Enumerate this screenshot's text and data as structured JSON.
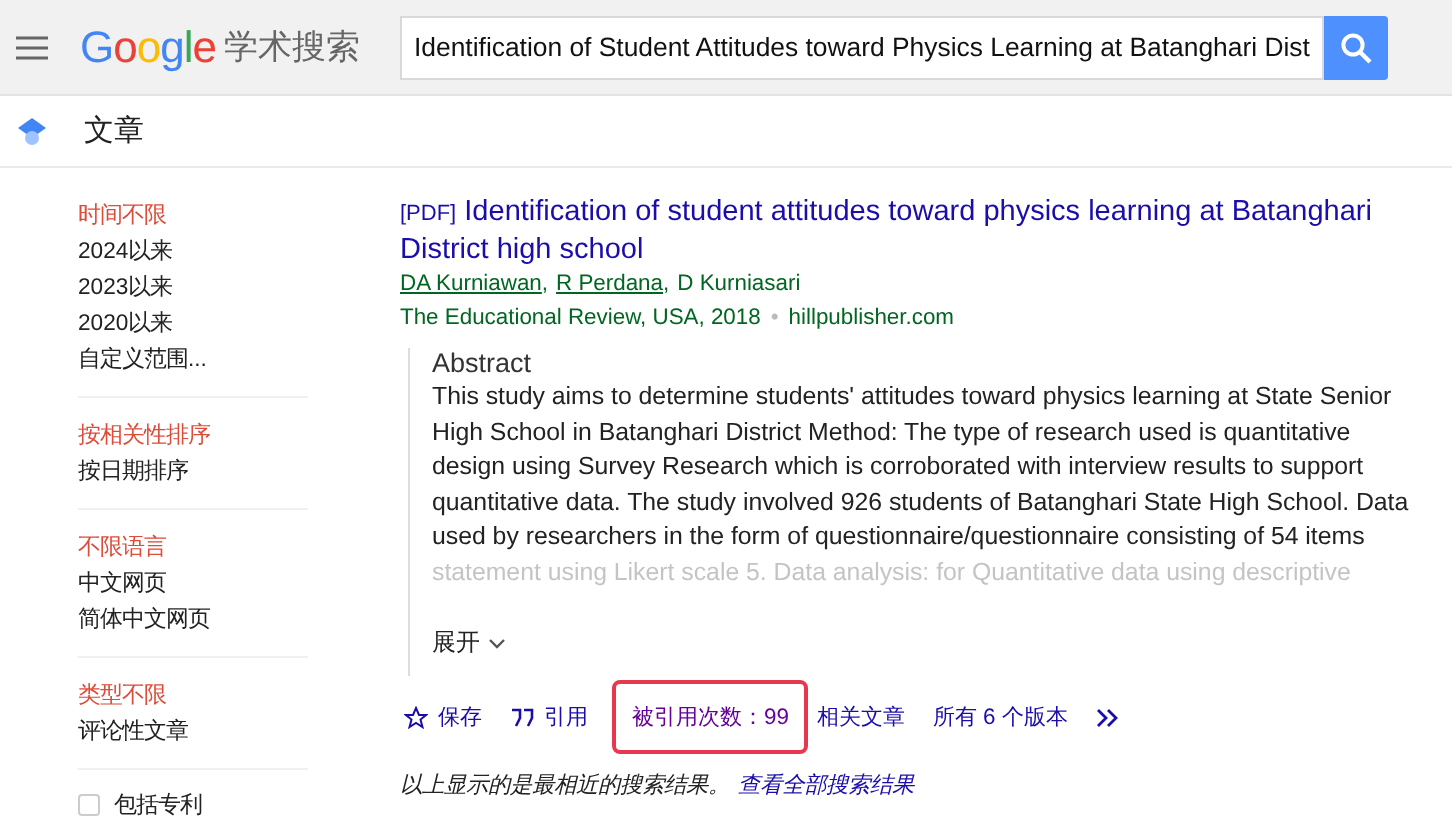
{
  "header": {
    "logo": "Google",
    "product": "学术搜索",
    "search_value": "Identification of Student Attitudes toward Physics Learning at Batanghari Dist"
  },
  "subbar": {
    "label": "文章"
  },
  "sidebar": {
    "groups": [
      {
        "items": [
          {
            "label": "时间不限",
            "selected": true
          },
          {
            "label": "2024以来",
            "selected": false
          },
          {
            "label": "2023以来",
            "selected": false
          },
          {
            "label": "2020以来",
            "selected": false
          },
          {
            "label": "自定义范围...",
            "selected": false
          }
        ]
      },
      {
        "items": [
          {
            "label": "按相关性排序",
            "selected": true
          },
          {
            "label": "按日期排序",
            "selected": false
          }
        ]
      },
      {
        "items": [
          {
            "label": "不限语言",
            "selected": true
          },
          {
            "label": "中文网页",
            "selected": false
          },
          {
            "label": "简体中文网页",
            "selected": false
          }
        ]
      },
      {
        "items": [
          {
            "label": "类型不限",
            "selected": true
          },
          {
            "label": "评论性文章",
            "selected": false
          }
        ]
      }
    ],
    "patents": {
      "label": "包括专利",
      "checked": false
    }
  },
  "result": {
    "format": "[PDF]",
    "title": "Identification of student attitudes toward physics learning at Batanghari District high school",
    "authors": [
      {
        "name": "DA Kurniawan",
        "linked": true
      },
      {
        "name": "R Perdana",
        "linked": true
      },
      {
        "name": "D Kurniasari",
        "linked": false
      }
    ],
    "author_separator": ",",
    "source_separator": "•",
    "source": "The Educational Review, USA, 2018",
    "domain": "hillpublisher.com",
    "abstract_heading": "Abstract",
    "abstract": "This study aims to determine students' attitudes toward physics learning at State Senior High School in Batanghari District Method: The type of research used is quantitative design using Survey Research which is corroborated with interview results to support quantitative data. The study involved 926 students of Batanghari State High School. Data used by researchers in the form of questionnaire/questionnaire consisting of 54 items",
    "abstract_faded": "statement using Likert scale 5. Data analysis: for Quantitative data using descriptive",
    "expand": "展开",
    "actions": [
      {
        "kind": "save",
        "label": "保存",
        "visited": false,
        "highlighted": false
      },
      {
        "kind": "cite",
        "label": "引用",
        "visited": false,
        "highlighted": false
      },
      {
        "kind": "link",
        "label": "被引用次数：99",
        "visited": true,
        "highlighted": true
      },
      {
        "kind": "link",
        "label": "相关文章",
        "visited": false,
        "highlighted": false
      },
      {
        "kind": "link",
        "label": "所有 6 个版本",
        "visited": false,
        "highlighted": false
      }
    ],
    "more_button": true
  },
  "footer": {
    "note": "以上显示的是最相近的搜索结果。",
    "link": "查看全部搜索结果"
  }
}
